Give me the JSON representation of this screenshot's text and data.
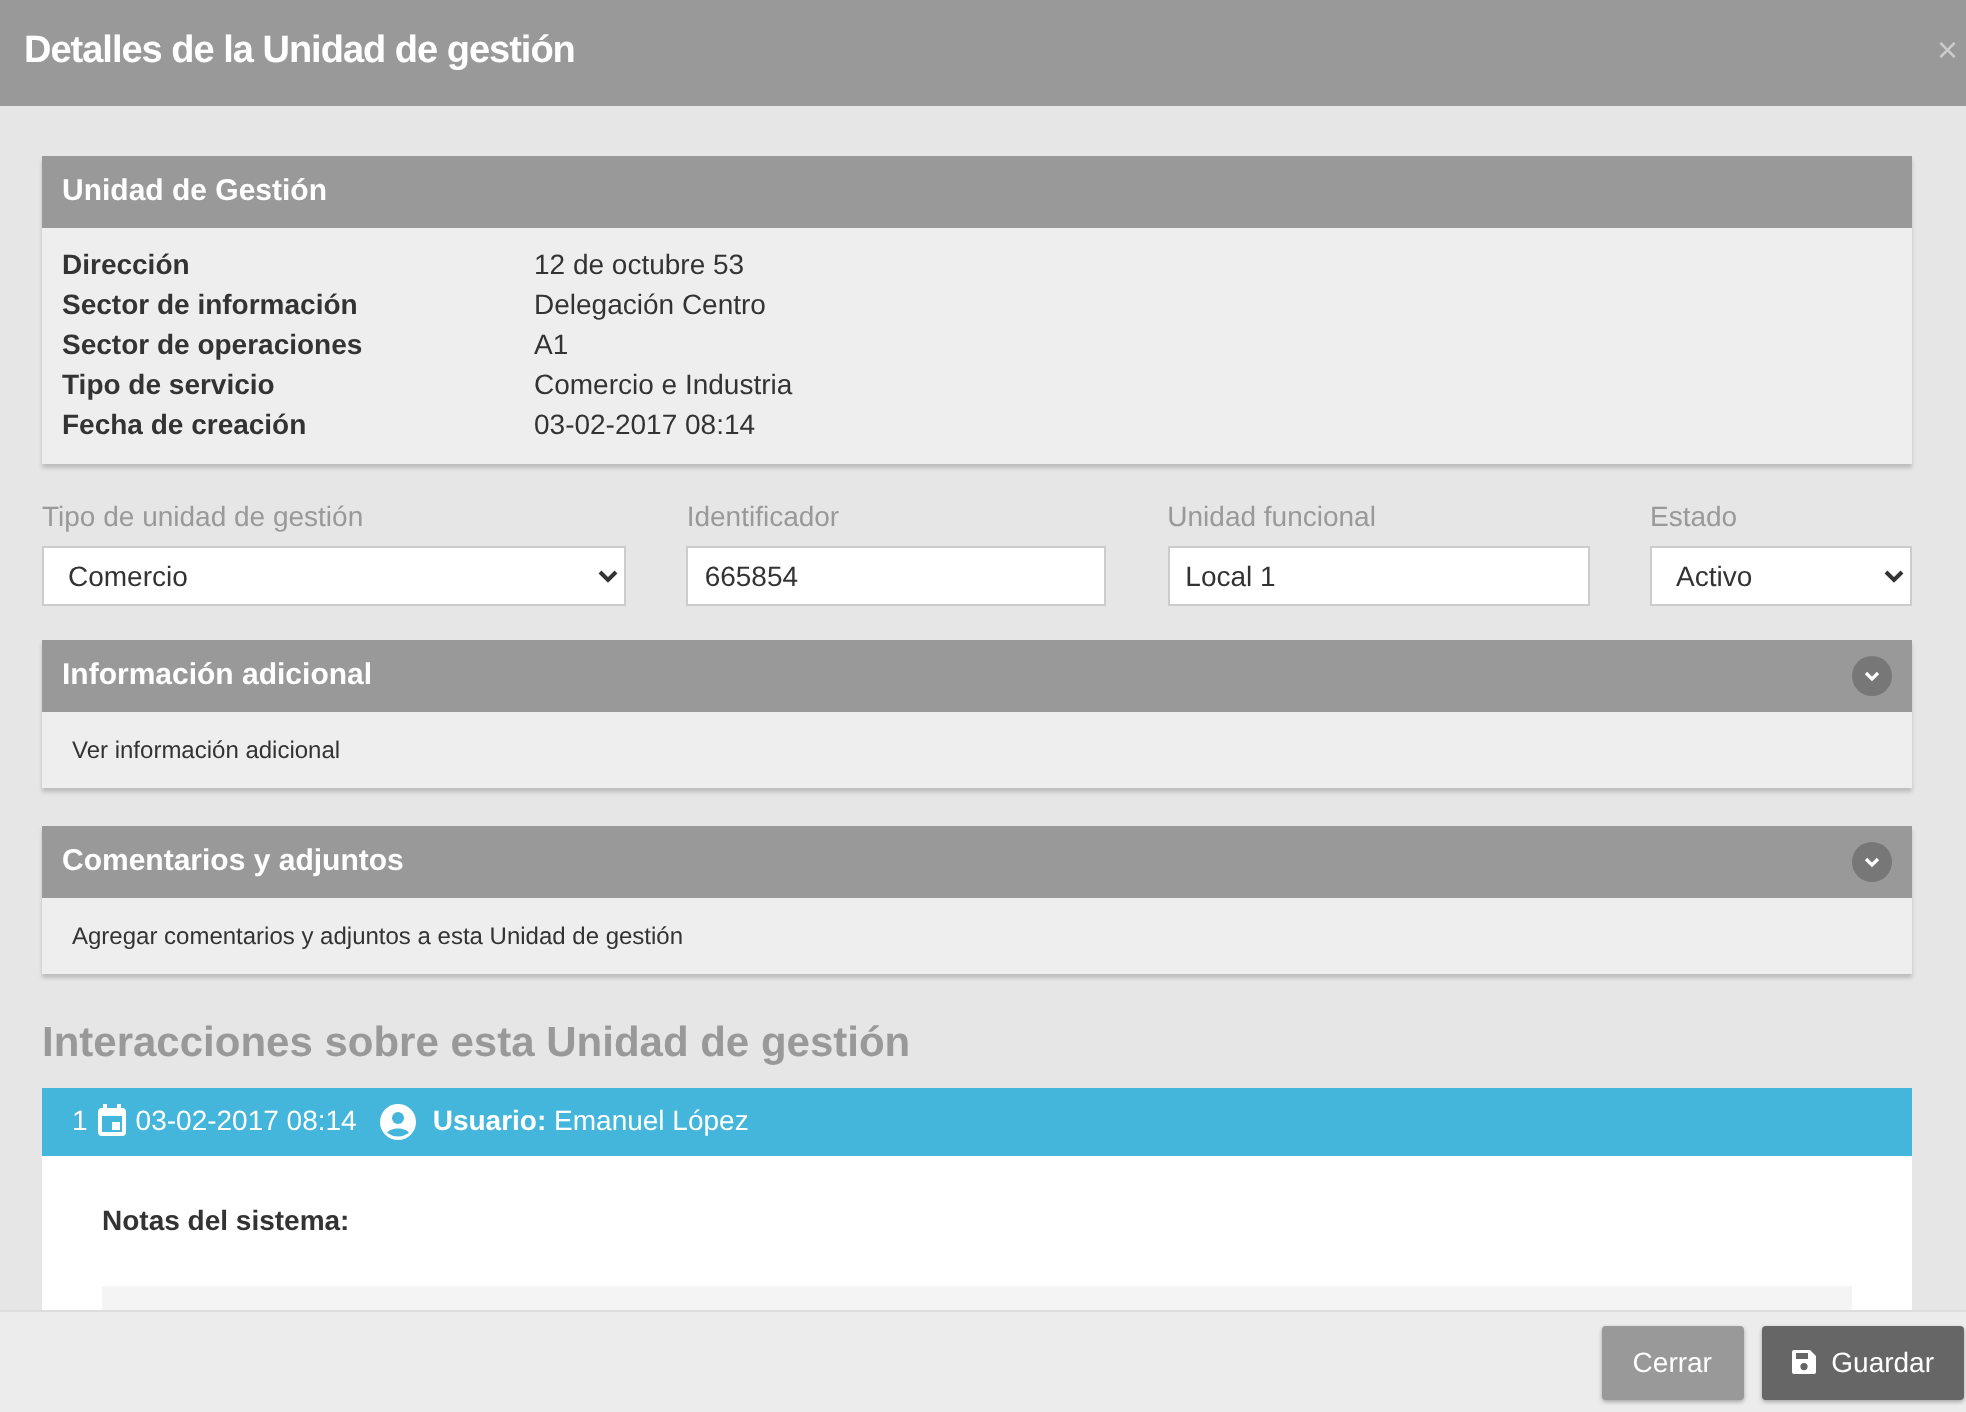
{
  "window": {
    "title": "Detalles de la Unidad de gestión",
    "close": "×"
  },
  "summary": {
    "title": "Unidad de Gestión",
    "rows": [
      {
        "label": "Dirección",
        "value": "12 de octubre 53"
      },
      {
        "label": "Sector de información",
        "value": "Delegación Centro"
      },
      {
        "label": "Sector de operaciones",
        "value": "A1"
      },
      {
        "label": "Tipo de servicio",
        "value": "Comercio e Industria"
      },
      {
        "label": "Fecha de creación",
        "value": "03-02-2017 08:14"
      }
    ]
  },
  "fields": [
    {
      "kind": "select",
      "label": "Tipo de unidad de gestión",
      "value": "Comercio"
    },
    {
      "kind": "input",
      "label": "Identificador",
      "value": "665854"
    },
    {
      "kind": "input",
      "label": "Unidad funcional",
      "value": "Local 1"
    },
    {
      "kind": "select",
      "label": "Estado",
      "value": "Activo"
    }
  ],
  "sections": [
    {
      "title": "Información adicional",
      "text": "Ver información adicional",
      "expanded": false
    },
    {
      "title": "Comentarios y adjuntos",
      "text": "Agregar comentarios y adjuntos a esta Unidad de gestión",
      "expanded": false
    }
  ],
  "interactions": {
    "title": "Interacciones sobre esta Unidad de gestión",
    "items": [
      {
        "number": "1",
        "date": "03-02-2017 08:14",
        "user": "**Usuario:** Emanuel López",
        "notes_title": "Notas del sistema:"
      }
    ]
  },
  "buttons": [
    {
      "kind": "secondary",
      "label": "Cerrar"
    },
    {
      "kind": "primary",
      "label": "Guardar"
    }
  ]
}
